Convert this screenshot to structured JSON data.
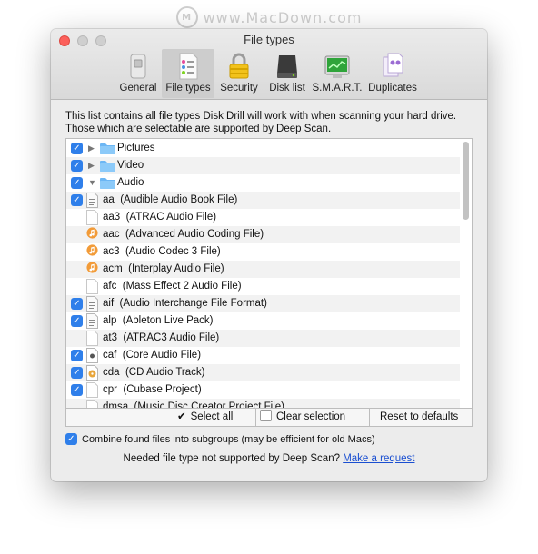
{
  "watermark": {
    "logo": "M",
    "text": "www.MacDown.com"
  },
  "window": {
    "title": "File types"
  },
  "tabs": [
    {
      "label": "General",
      "icon": "switch-icon"
    },
    {
      "label": "File types",
      "icon": "file-list-icon"
    },
    {
      "label": "Security",
      "icon": "padlock-icon"
    },
    {
      "label": "Disk list",
      "icon": "hard-drive-icon"
    },
    {
      "label": "S.M.A.R.T.",
      "icon": "monitor-icon"
    },
    {
      "label": "Duplicates",
      "icon": "duplicate-files-icon"
    }
  ],
  "description": {
    "line1": "This list contains all file types Disk Drill will work with when scanning your hard drive.",
    "line2": "Those which are selectable are supported by Deep Scan."
  },
  "list": {
    "groups": [
      {
        "name": "Pictures",
        "checked": true,
        "expanded": false
      },
      {
        "name": "Video",
        "checked": true,
        "expanded": false
      },
      {
        "name": "Audio",
        "checked": true,
        "expanded": true
      }
    ],
    "files": [
      {
        "ext": "aa",
        "desc": "(Audible Audio Book File)",
        "checked": true,
        "icon": "doc"
      },
      {
        "ext": "aa3",
        "desc": "(ATRAC Audio File)",
        "checked": false,
        "icon": "blank"
      },
      {
        "ext": "aac",
        "desc": "(Advanced Audio Coding File)",
        "checked": false,
        "icon": "music"
      },
      {
        "ext": "ac3",
        "desc": "(Audio Codec 3 File)",
        "checked": false,
        "icon": "music"
      },
      {
        "ext": "acm",
        "desc": "(Interplay Audio File)",
        "checked": false,
        "icon": "music"
      },
      {
        "ext": "afc",
        "desc": "(Mass Effect 2 Audio File)",
        "checked": false,
        "icon": "blank"
      },
      {
        "ext": "aif",
        "desc": "(Audio Interchange File Format)",
        "checked": true,
        "icon": "doc"
      },
      {
        "ext": "alp",
        "desc": "(Ableton Live Pack)",
        "checked": true,
        "icon": "doc"
      },
      {
        "ext": "at3",
        "desc": "(ATRAC3 Audio File)",
        "checked": false,
        "icon": "blank"
      },
      {
        "ext": "caf",
        "desc": "(Core Audio File)",
        "checked": true,
        "icon": "core"
      },
      {
        "ext": "cda",
        "desc": "(CD Audio Track)",
        "checked": true,
        "icon": "cd"
      },
      {
        "ext": "cpr",
        "desc": "(Cubase Project)",
        "checked": true,
        "icon": "blank"
      },
      {
        "ext": "dmsa",
        "desc": "(Music Disc Creator Project File)",
        "checked": false,
        "icon": "blank"
      }
    ]
  },
  "buttons": {
    "select_all": "Select all",
    "clear_selection": "Clear selection",
    "reset_defaults": "Reset to defaults"
  },
  "combine": {
    "label": "Combine found files into subgroups (may be efficient for old Macs)",
    "checked": true
  },
  "needed": {
    "text": "Needed file type not supported by Deep Scan?",
    "link": "Make a request"
  },
  "colors": {
    "accent": "#2f7fea",
    "link": "#1a4fd1",
    "music_icon": "#f29b38"
  }
}
